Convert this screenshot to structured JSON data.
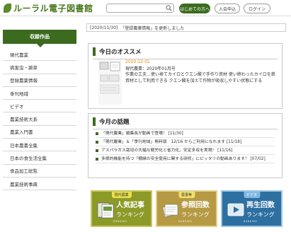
{
  "header": {
    "logo_text": "ルーラル電子図書館",
    "search": {
      "placeholder": ""
    },
    "buttons": {
      "about": "はじめての方へ",
      "signup": "入会申込",
      "login": "ログイン"
    }
  },
  "notice": {
    "date": "[2020/11/30]",
    "text": "「登録農薬情報」を更新しました"
  },
  "sidebar": {
    "title": "収録作品",
    "items": [
      "現代農業",
      "病害虫・雑草",
      "登録農薬情報",
      "季刊地域",
      "ビデオ",
      "農業技術大系",
      "農業入門書",
      "日本農書全集",
      "日本の食生活全集",
      "食品加工総覧",
      "農業技術事典"
    ]
  },
  "featured": {
    "title": "今日のオススメ",
    "date": "2020-12-01",
    "source": "現代農業：2020年01月号",
    "body": "作業の工夫…使い捨てカイロとクエン酸で手作り資材 使い終わったカイロを鉄資材として利用できる クエン酸を加えて作物が吸収しやすい状態にする"
  },
  "topics": {
    "title": "今月の話題",
    "items": [
      "「現代農業」編集長が動画で登場！ [11/30]",
      "「現代農業」＆「季刊地域」無料版　12/16 からご利用になれます [11/18]",
      "アスパラガス栽培の大幅な軽労化と省力化、安定多収を実現！ [11/16]",
      "多様的機能を持つ「棚縁の安全使用に関する研修」にピッタリの動画あります！ [07/02]"
    ]
  },
  "banners": [
    {
      "tag": "現代農業",
      "line1": "人気記事",
      "line2": "ランキング",
      "sub": "RANKING"
    },
    {
      "tag": "農書等",
      "line1": "参照回数",
      "line2": "ランキング",
      "sub": "RANKING"
    },
    {
      "tag": "ビデオ",
      "line1": "再生回数",
      "line2": "ランキング",
      "sub": "RANKING"
    }
  ],
  "colors": {
    "brand_green": "#3c6b1f",
    "accent_orange": "#e08a00"
  },
  "icons": {
    "search": "search-icon",
    "logo": "leaf-icon"
  }
}
